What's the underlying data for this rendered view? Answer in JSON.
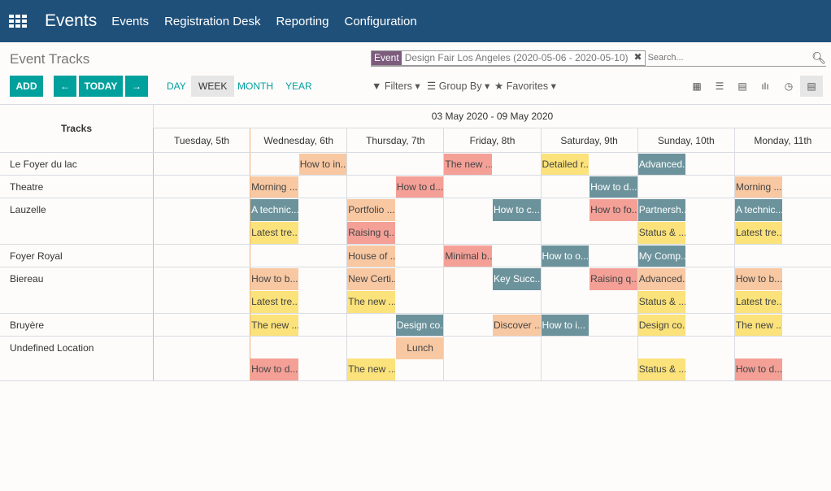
{
  "navbar": {
    "app_title": "Events",
    "menu": [
      "Events",
      "Registration Desk",
      "Reporting",
      "Configuration"
    ],
    "color": "#1f507a"
  },
  "page_title": "Event Tracks",
  "buttons": {
    "add": "ADD",
    "prev": "←",
    "today": "TODAY",
    "next": "→"
  },
  "modes": [
    "DAY",
    "WEEK",
    "MONTH",
    "YEAR"
  ],
  "active_mode": "WEEK",
  "search": {
    "facet_key": "Event",
    "facet_value": "Design Fair Los Angeles (2020-05-06 - 2020-05-10)",
    "placeholder": "Search..."
  },
  "dropdowns": [
    "Filters",
    "Group By",
    "Favorites"
  ],
  "view_icons": [
    "kanban-icon",
    "list-icon",
    "calendar-icon",
    "graph-icon",
    "activity-icon",
    "gantt-icon"
  ],
  "gantt": {
    "group_header": "Tracks",
    "range": "03 May 2020 - 09 May 2020",
    "days": [
      "Tuesday, 5th",
      "Wednesday, 6th",
      "Thursday, 7th",
      "Friday, 8th",
      "Saturday, 9th",
      "Sunday, 10th",
      "Monday, 11th"
    ],
    "colors": {
      "teal": "#6c939c",
      "peach": "#f8c8a2",
      "red": "#f4a097",
      "yellow": "#fbe27a"
    },
    "rows": [
      {
        "name": "Le Foyer du lac",
        "lines": 1,
        "pills": [
          {
            "t": "How to in...",
            "slot": 3,
            "c": "peach",
            "l": 0
          },
          {
            "t": "The new ...",
            "slot": 6,
            "c": "red",
            "l": 0
          },
          {
            "t": "Detailed r...",
            "slot": 8,
            "c": "yellow",
            "l": 0
          },
          {
            "t": "Advanced...",
            "slot": 10,
            "c": "teal",
            "l": 0
          }
        ]
      },
      {
        "name": "Theatre",
        "lines": 1,
        "pills": [
          {
            "t": "Morning ...",
            "slot": 2,
            "c": "peach",
            "l": 0
          },
          {
            "t": "How to d...",
            "slot": 5,
            "c": "red",
            "l": 0
          },
          {
            "t": "How to d...",
            "slot": 9,
            "c": "teal",
            "l": 0
          },
          {
            "t": "Morning ...",
            "slot": 12,
            "c": "peach",
            "l": 0
          }
        ]
      },
      {
        "name": "Lauzelle",
        "lines": 2,
        "pills": [
          {
            "t": "A technic...",
            "slot": 2,
            "c": "teal",
            "l": 0
          },
          {
            "t": "Portfolio ...",
            "slot": 4,
            "c": "peach",
            "l": 0
          },
          {
            "t": "How to c...",
            "slot": 7,
            "c": "teal",
            "l": 0
          },
          {
            "t": "How to fo...",
            "slot": 9,
            "c": "red",
            "l": 0
          },
          {
            "t": "Partnersh...",
            "slot": 10,
            "c": "teal",
            "l": 0
          },
          {
            "t": "A technic...",
            "slot": 12,
            "c": "teal",
            "l": 0
          },
          {
            "t": "Latest tre...",
            "slot": 2,
            "c": "yellow",
            "l": 1
          },
          {
            "t": "Raising q...",
            "slot": 4,
            "c": "red",
            "l": 1
          },
          {
            "t": "Status & ...",
            "slot": 10,
            "c": "yellow",
            "l": 1
          },
          {
            "t": "Latest tre...",
            "slot": 12,
            "c": "yellow",
            "l": 1
          }
        ]
      },
      {
        "name": "Foyer Royal",
        "lines": 1,
        "pills": [
          {
            "t": "House of ...",
            "slot": 4,
            "c": "peach",
            "l": 0
          },
          {
            "t": "Minimal b...",
            "slot": 6,
            "c": "red",
            "l": 0
          },
          {
            "t": "How to o...",
            "slot": 8,
            "c": "teal",
            "l": 0
          },
          {
            "t": "My Comp...",
            "slot": 10,
            "c": "teal",
            "l": 0
          }
        ]
      },
      {
        "name": "Biereau",
        "lines": 2,
        "pills": [
          {
            "t": "How to b...",
            "slot": 2,
            "c": "peach",
            "l": 0
          },
          {
            "t": "New Certi...",
            "slot": 4,
            "c": "peach",
            "l": 0
          },
          {
            "t": "Key Succ...",
            "slot": 7,
            "c": "teal",
            "l": 0
          },
          {
            "t": "Raising q...",
            "slot": 9,
            "c": "red",
            "l": 0
          },
          {
            "t": "Advanced...",
            "slot": 10,
            "c": "peach",
            "l": 0
          },
          {
            "t": "How to b...",
            "slot": 12,
            "c": "peach",
            "l": 0
          },
          {
            "t": "Latest tre...",
            "slot": 2,
            "c": "yellow",
            "l": 1
          },
          {
            "t": "The new ...",
            "slot": 4,
            "c": "yellow",
            "l": 1
          },
          {
            "t": "Status & ...",
            "slot": 10,
            "c": "yellow",
            "l": 1
          },
          {
            "t": "Latest tre...",
            "slot": 12,
            "c": "yellow",
            "l": 1
          }
        ]
      },
      {
        "name": "Bruyère",
        "lines": 1,
        "pills": [
          {
            "t": "The new ...",
            "slot": 2,
            "c": "yellow",
            "l": 0
          },
          {
            "t": "Design co...",
            "slot": 5,
            "c": "teal",
            "l": 0
          },
          {
            "t": "Discover ...",
            "slot": 7,
            "c": "peach",
            "l": 0
          },
          {
            "t": "How to i...",
            "slot": 8,
            "c": "teal",
            "l": 0
          },
          {
            "t": "Design co...",
            "slot": 10,
            "c": "yellow",
            "l": 0
          },
          {
            "t": "The new ...",
            "slot": 12,
            "c": "yellow",
            "l": 0
          }
        ]
      },
      {
        "name": "Undefined Location",
        "lines": 2,
        "pills": [
          {
            "t": "Lunch",
            "slot": 5,
            "c": "peach",
            "l": 0,
            "center": true
          },
          {
            "t": "How to d...",
            "slot": 2,
            "c": "red",
            "l": 1
          },
          {
            "t": "The new ...",
            "slot": 4,
            "c": "yellow",
            "l": 1
          },
          {
            "t": "Status & ...",
            "slot": 10,
            "c": "yellow",
            "l": 1
          },
          {
            "t": "How to d...",
            "slot": 12,
            "c": "red",
            "l": 1
          }
        ]
      }
    ]
  }
}
